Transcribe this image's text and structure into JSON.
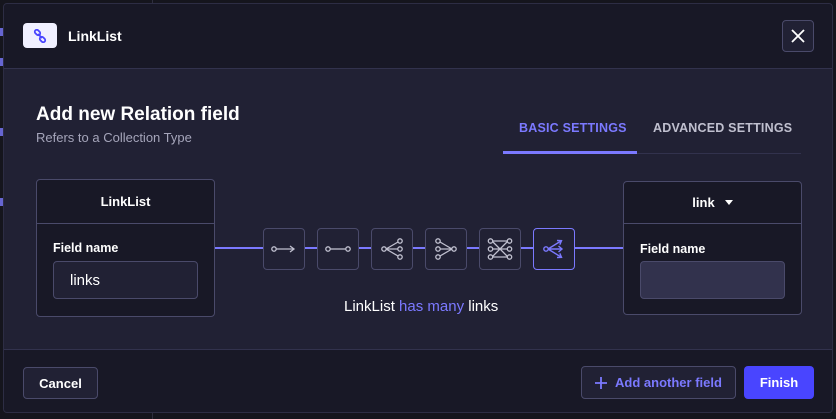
{
  "header": {
    "title": "LinkList",
    "icon": "link-icon",
    "close_icon": "close-icon"
  },
  "main": {
    "title": "Add new Relation field",
    "subtitle": "Refers to a Collection Type",
    "tabs": [
      {
        "label": "BASIC SETTINGS",
        "active": true
      },
      {
        "label": "ADVANCED SETTINGS",
        "active": false
      }
    ]
  },
  "left_card": {
    "title": "LinkList",
    "field_label": "Field name",
    "field_value": "links"
  },
  "right_card": {
    "title": "link",
    "dropdown_icon": "caret-down-icon",
    "field_label": "Field name",
    "field_value": ""
  },
  "relation_types": [
    {
      "icon": "one-way-icon",
      "active": false
    },
    {
      "icon": "one-to-one-icon",
      "active": false
    },
    {
      "icon": "one-to-many-icon",
      "active": false
    },
    {
      "icon": "many-to-one-icon",
      "active": false
    },
    {
      "icon": "many-to-many-icon",
      "active": false
    },
    {
      "icon": "many-way-icon",
      "active": true
    }
  ],
  "description": {
    "source": "LinkList",
    "relation": "has many",
    "target": "links"
  },
  "footer": {
    "cancel_label": "Cancel",
    "add_label": "Add another field",
    "add_icon": "plus-icon",
    "finish_label": "Finish"
  },
  "colors": {
    "accent": "#7b79ff",
    "primary": "#4945ff",
    "background": "#212134"
  }
}
